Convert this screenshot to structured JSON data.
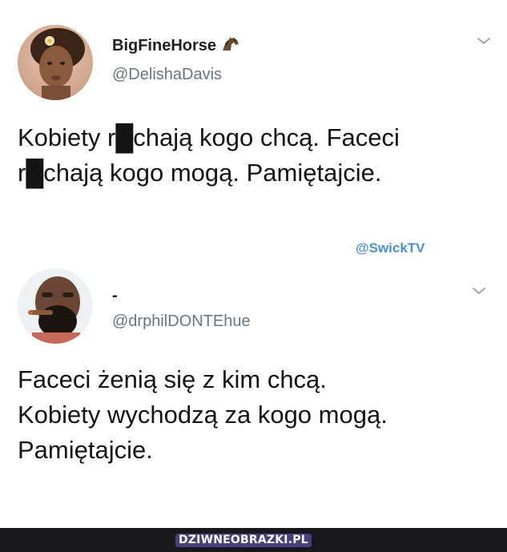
{
  "tweet1": {
    "display_name": "BigFineHorse",
    "handle": "@DelishaDavis",
    "text": "Kobiety r█chają kogo chcą. Faceci\nr█chają kogo mogą. Pamiętajcie.",
    "avatar_icon": "avatar-woman-photo",
    "badge_icon": "horse-emoji-icon",
    "menu_icon": "chevron-down-icon"
  },
  "credit": {
    "label": "@SwickTV",
    "color": "#4a8fd8"
  },
  "tweet2": {
    "display_name": "-",
    "handle": "@drphilDONTEhue",
    "text": "Faceci żenią się z kim chcą.\nKobiety wychodzą za kogo mogą.\nPamiętajcie.",
    "avatar_icon": "avatar-man-photo",
    "menu_icon": "chevron-down-icon"
  },
  "footer": {
    "logo_text": "DZIWNEOBRAZKI.PL",
    "background": "#18181c",
    "accent": "#4b3f7a"
  }
}
